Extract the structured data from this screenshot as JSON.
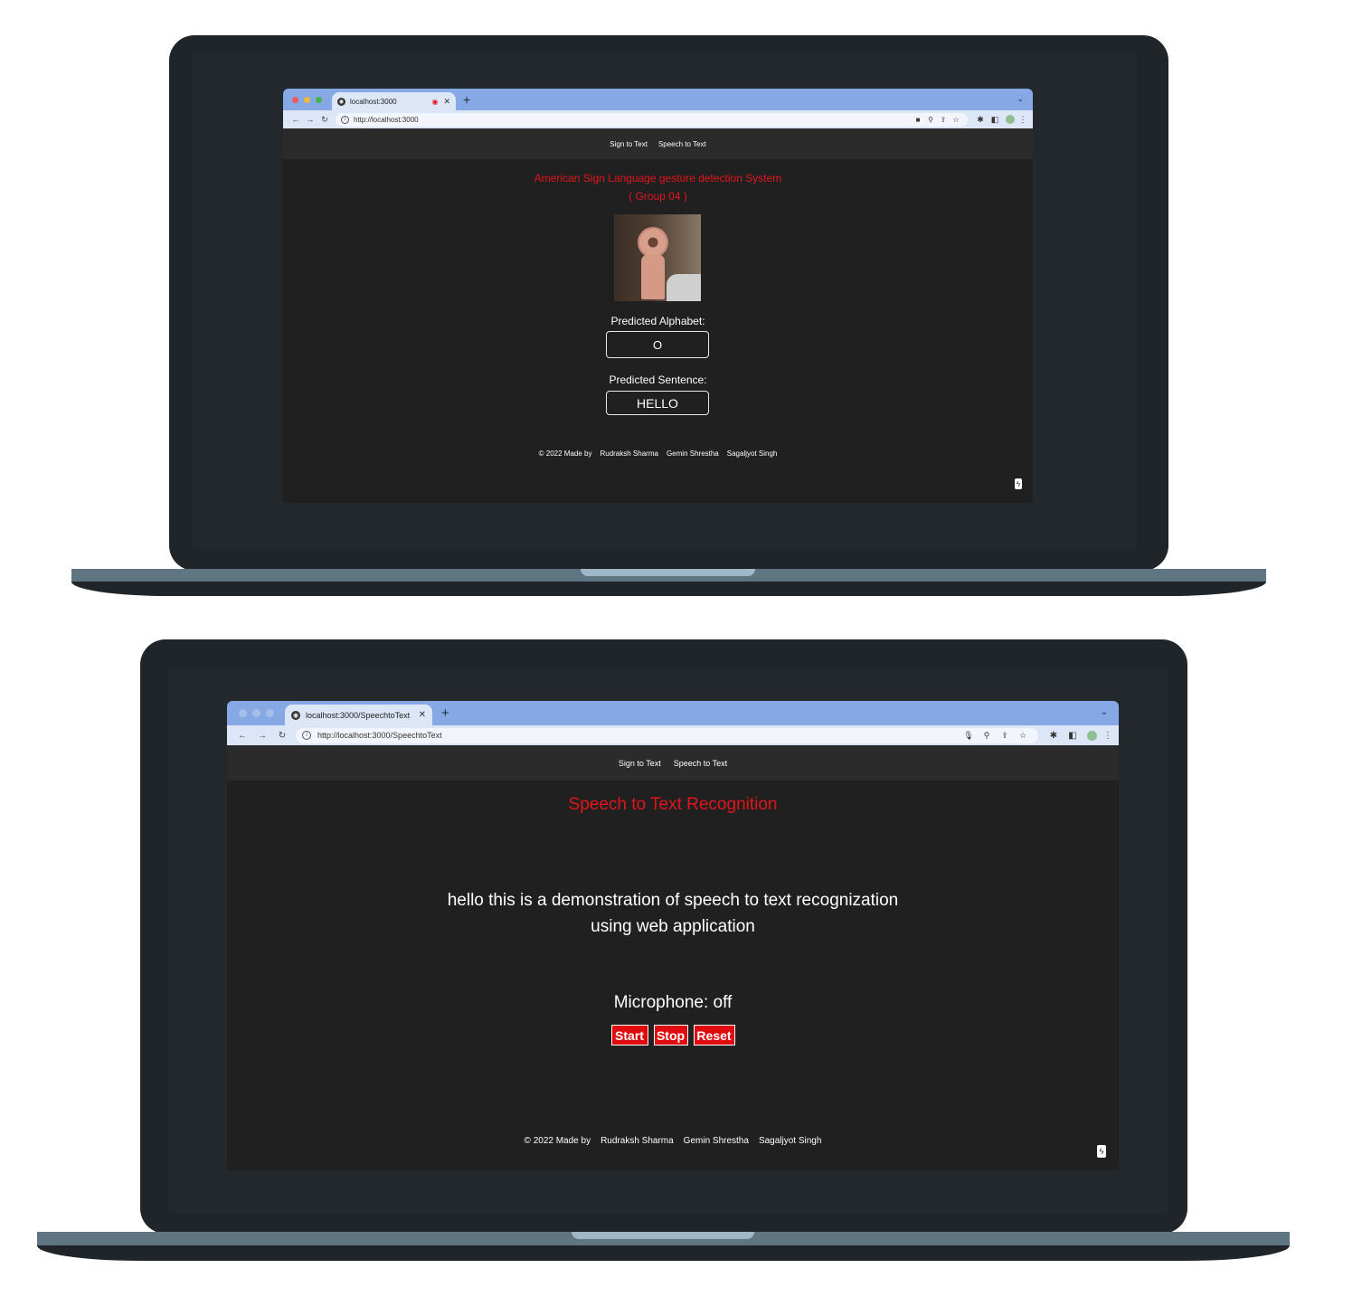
{
  "top_screen": {
    "tab": {
      "title": "localhost:3000"
    },
    "address": {
      "url": "http://localhost:3000"
    },
    "nav": {
      "items": [
        "Sign to Text",
        "Speech to Text"
      ]
    },
    "heading": {
      "line1": "American Sign Language gesture detection System",
      "line2": "( Group 04 )"
    },
    "camera": {
      "description": "webcam-hand-gesture"
    },
    "predicted_alphabet": {
      "label": "Predicted Alphabet:",
      "value": "O"
    },
    "predicted_sentence": {
      "label": "Predicted Sentence:",
      "value": "HELLO"
    },
    "footer": {
      "prefix": "© 2022 Made by",
      "authors": [
        "Rudraksh Sharma",
        "Gemin Shrestha",
        "Sagaljyot Singh"
      ]
    }
  },
  "bottom_screen": {
    "tab": {
      "title": "localhost:3000/SpeechtoText"
    },
    "address": {
      "url": "http://localhost:3000/SpeechtoText"
    },
    "nav": {
      "items": [
        "Sign to Text",
        "Speech to Text"
      ]
    },
    "heading": "Speech to Text Recognition",
    "transcript": {
      "line1": "hello this is a demonstration of speech to text recognization",
      "line2": "using web application"
    },
    "microphone_status": "Microphone: off",
    "buttons": {
      "start": "Start",
      "stop": "Stop",
      "reset": "Reset"
    },
    "footer": {
      "prefix": "© 2022 Made by",
      "authors": [
        "Rudraksh Sharma",
        "Gemin Shrestha",
        "Sagaljyot Singh"
      ]
    }
  },
  "colors": {
    "accent_red": "#e4141b",
    "tabbar_blue": "#86a9e6",
    "page_bg": "#202020",
    "laptop_frame": "#1f2529"
  }
}
